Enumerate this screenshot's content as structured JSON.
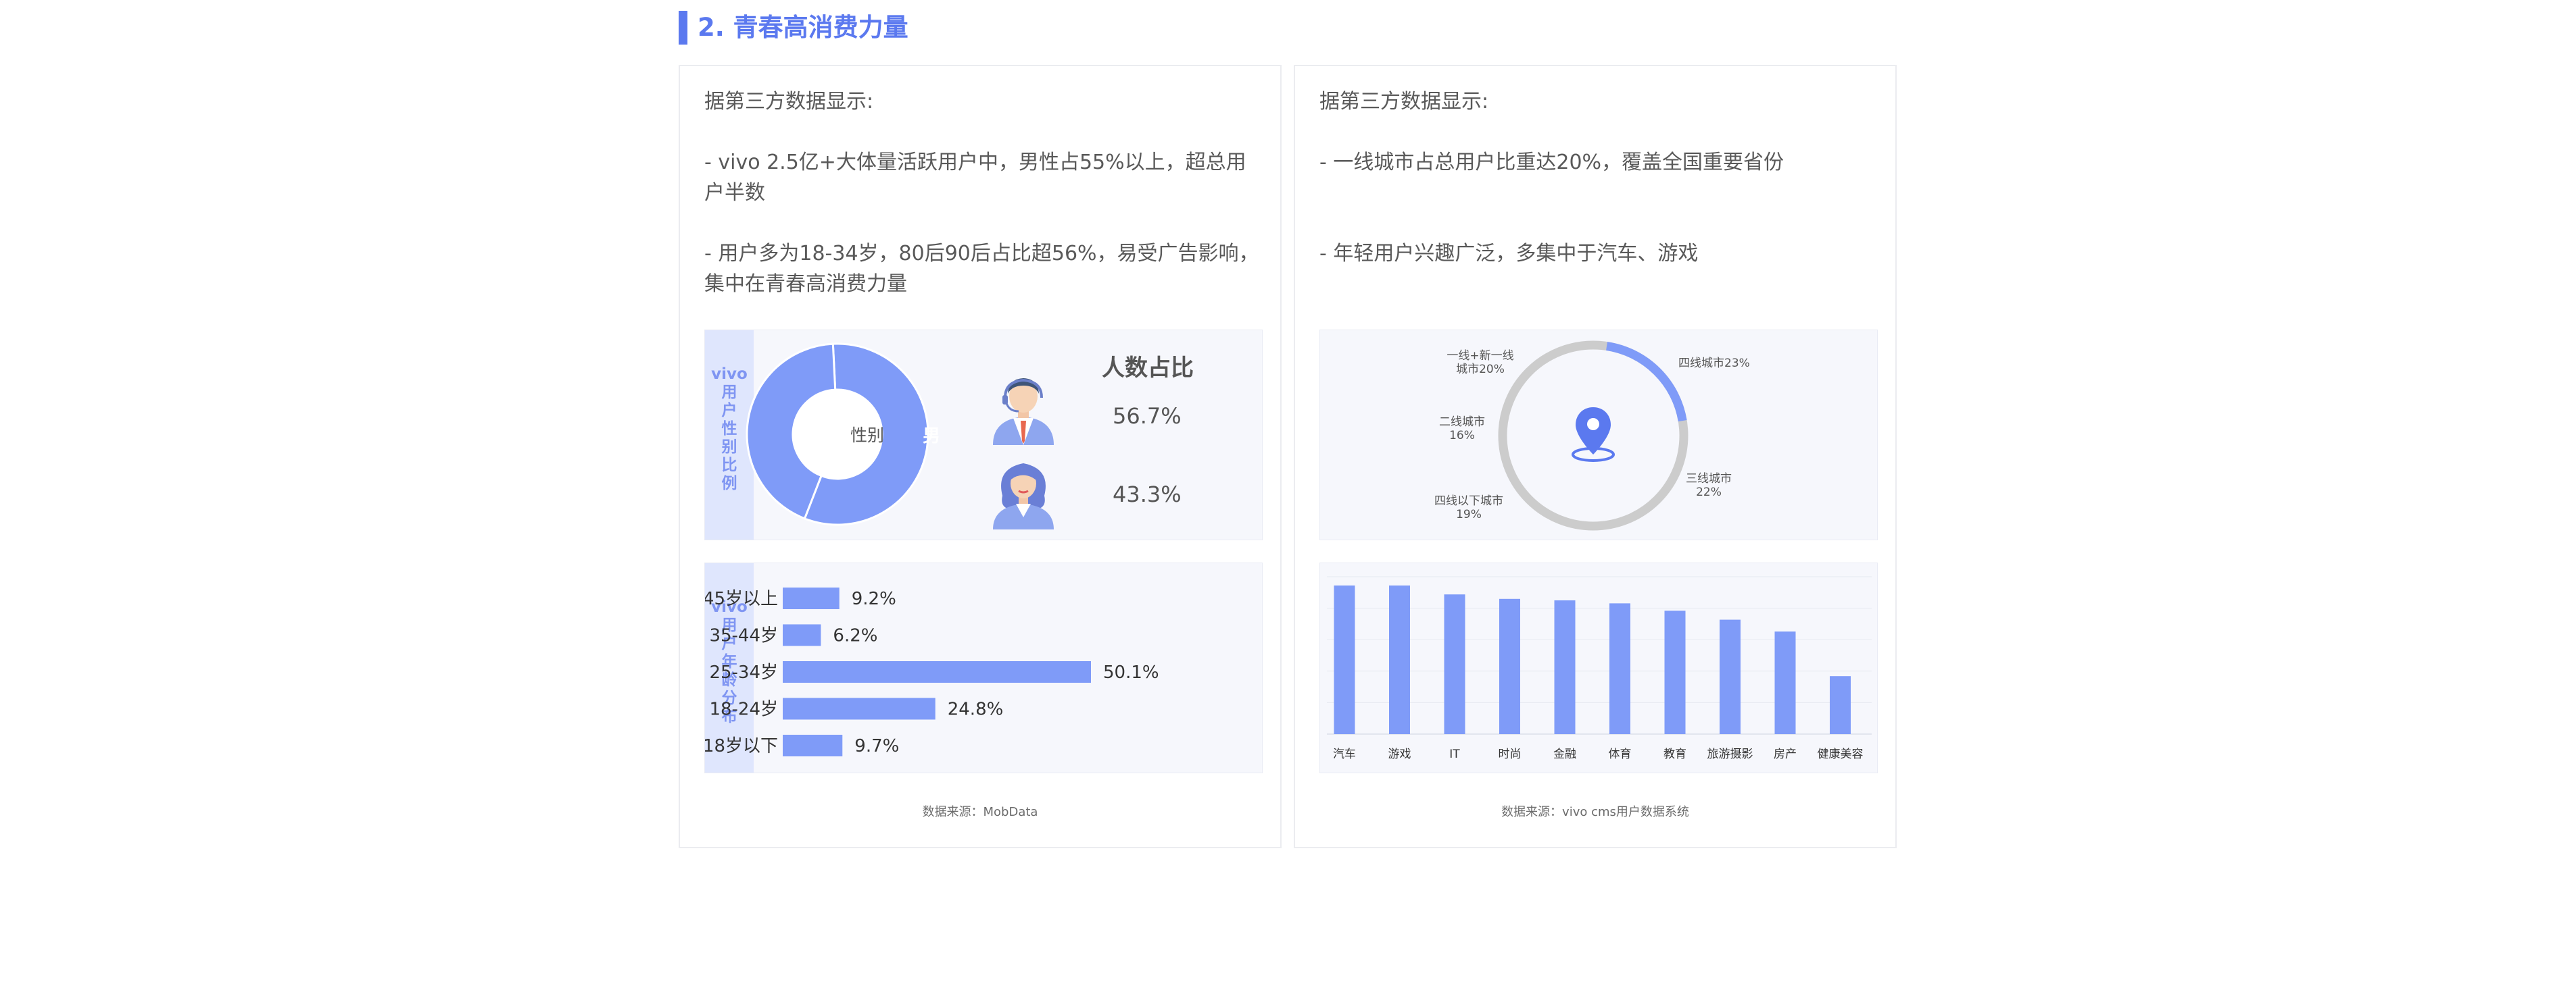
{
  "section": {
    "title": "2. 青春高消费力量"
  },
  "left_card": {
    "intro": "据第三方数据显示:",
    "point1": "- vivo 2.5亿+大体量活跃用户中，男性占55%以上，超总用户半数",
    "point2": "- 用户多为18-34岁，80后90后占比超56%，易受广告影响，集中在青春高消费力量",
    "gender_panel": {
      "side_label": "vivo\n用\n户\n性\n别\n比\n例",
      "heading": "人数占比",
      "center_label": "性别",
      "female_label": "女",
      "male_label": "男",
      "male_pct": "56.7%",
      "female_pct": "43.3%"
    },
    "age_panel": {
      "side_label": "vivo\n用\n户\n年\n龄\n分\n布"
    },
    "source": "数据来源：MobData"
  },
  "right_card": {
    "intro": "据第三方数据显示:",
    "point1": "- 一线城市占总用户比重达20%，覆盖全国重要省份",
    "point2": "- 年轻用户兴趣广泛，多集中于汽车、游戏",
    "city_labels": {
      "tier1": "一线+新一线\n城市20%",
      "tier4": "四线城市23%",
      "tier2": "二线城市\n16%",
      "tier3": "三线城市\n22%",
      "below4": "四线以下城市\n19%"
    },
    "source": "数据来源：vivo cms用户数据系统"
  },
  "chart_data": [
    {
      "type": "pie",
      "title": "人数占比",
      "categories": [
        "男",
        "女"
      ],
      "values": [
        56.7,
        43.3
      ]
    },
    {
      "type": "bar",
      "orientation": "horizontal",
      "categories": [
        "45岁以上",
        "35-44岁",
        "25-34岁",
        "18-24岁",
        "18岁以下"
      ],
      "values": [
        9.2,
        6.2,
        50.1,
        24.8,
        9.7
      ],
      "value_labels": [
        "9.2%",
        "6.2%",
        "50.1%",
        "24.8%",
        "9.7%"
      ]
    },
    {
      "type": "pie",
      "categories": [
        "一线+新一线城市",
        "四线城市",
        "三线城市",
        "四线以下城市",
        "二线城市"
      ],
      "values": [
        20,
        23,
        22,
        19,
        16
      ]
    },
    {
      "type": "bar",
      "categories": [
        "汽车",
        "游戏",
        "IT",
        "时尚",
        "金融",
        "体育",
        "教育",
        "旅游摄影",
        "房产",
        "健康美容"
      ],
      "values": [
        100,
        100,
        94,
        91,
        90,
        88,
        83,
        77,
        69,
        39
      ],
      "grid": true
    }
  ],
  "colors": {
    "accent": "#5b79ef",
    "bar": "#7f9bf8",
    "ring_gray": "#cccccc",
    "side_panel": "#dfe6fd"
  },
  "icons": {
    "male_avatar": "male-agent-avatar-icon",
    "female_avatar": "female-agent-avatar-icon",
    "location": "location-pin-icon"
  }
}
